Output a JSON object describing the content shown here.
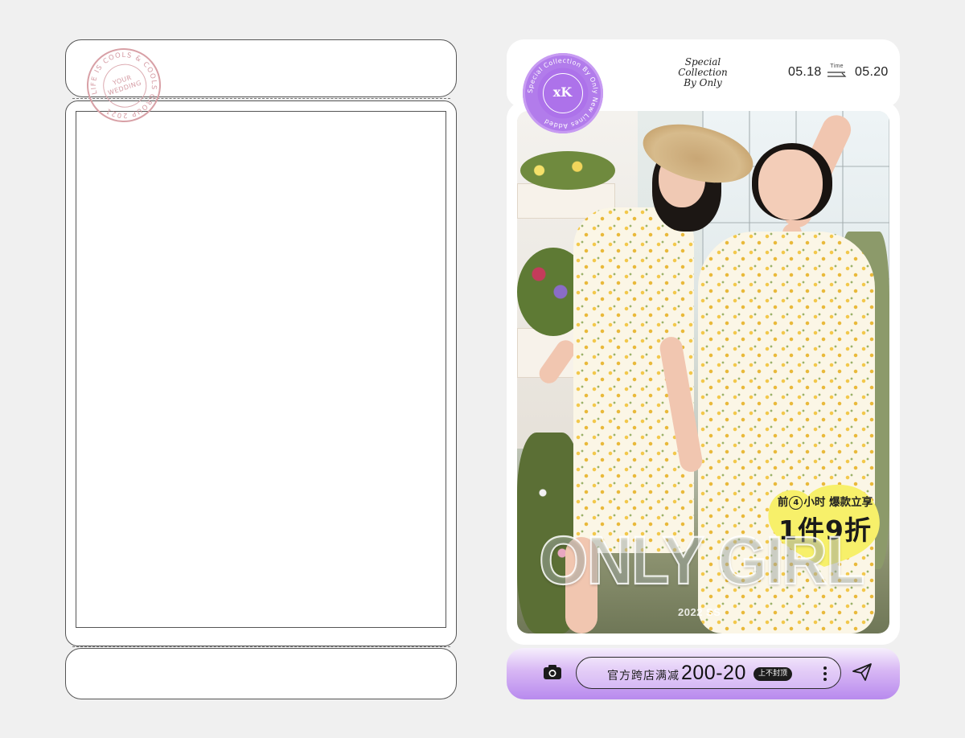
{
  "template": {
    "stamp": {
      "ring_text": "LIFE IS COOLS & COOLS GROUP 2021",
      "center_text": "YOUR WEDDING"
    }
  },
  "poster": {
    "sticker_text": "Special Collection By Only New Lines Added",
    "sticker_logo": "xK",
    "special_line1": "Special Collection",
    "special_line2": "By Only",
    "date_start": "05.18",
    "date_label": "Time",
    "date_end": "05.20",
    "promo_line1_prefix": "前",
    "promo_line1_number": "4",
    "promo_line1_suffix": "小时 爆款立享",
    "promo_line2": "1件9折",
    "headline": "ONLY GIRL",
    "season": "2022 SS",
    "footer": {
      "camera_icon": "camera-icon",
      "offer_text": "官方跨店满减",
      "offer_amount": "200-20",
      "offer_tag": "上不封顶",
      "more_icon": "more-vertical-icon",
      "send_icon": "send-icon"
    },
    "colors": {
      "purple_light": "#d7b6f4",
      "purple_dark": "#b88aee",
      "badge_yellow": "#f7f06a"
    }
  }
}
